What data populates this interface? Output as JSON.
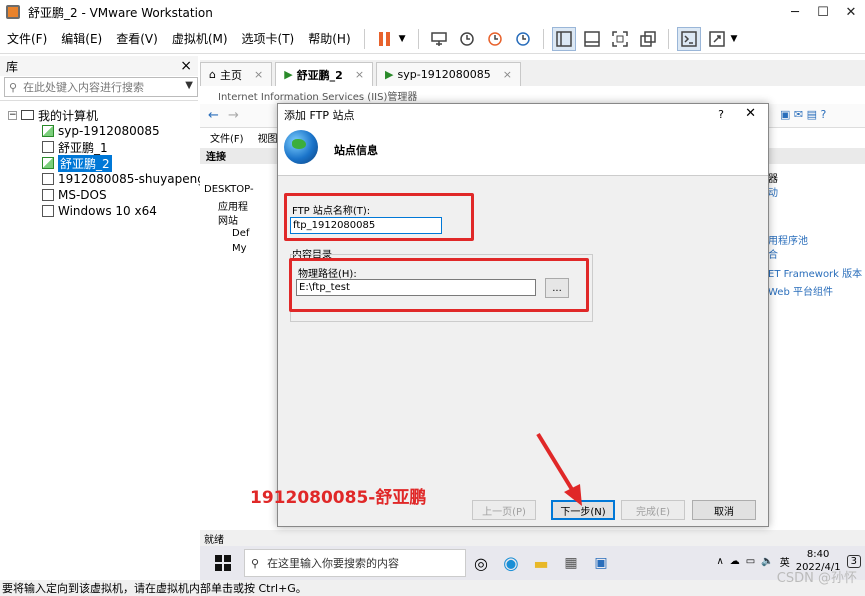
{
  "window": {
    "title": "舒亚鹏_2 - VMware Workstation"
  },
  "menu": {
    "items": [
      "文件(F)",
      "编辑(E)",
      "查看(V)",
      "虚拟机(M)",
      "选项卡(T)",
      "帮助(H)"
    ]
  },
  "library": {
    "title": "库",
    "close": "×",
    "search_placeholder": "在此处键入内容进行搜索",
    "root": "我的计算机",
    "vms": [
      "syp-1912080085",
      "舒亚鹏_1",
      "舒亚鹏_2",
      "1912080085-shuyapeng",
      "MS-DOS",
      "Windows 10 x64"
    ],
    "selected_index": 2
  },
  "tabs": [
    {
      "label": "主页",
      "close": "×"
    },
    {
      "label": "舒亚鹏_2",
      "close": "×"
    },
    {
      "label": "syp-1912080085",
      "close": "×"
    }
  ],
  "iis": {
    "title": "Internet Information Services (IIS)管理器",
    "menu": [
      "文件(F)",
      "视图("
    ],
    "connections_header": "连接",
    "tree": [
      "DESKTOP-",
      "应用程",
      "网站",
      "Def",
      "My"
    ],
    "right_links": [
      "器",
      "动",
      "用程序池",
      "合",
      "ET Framework 版本",
      "Web 平台组件"
    ],
    "status": "就绪"
  },
  "dialog": {
    "title": "添加 FTP 站点",
    "help": "?",
    "close": "✕",
    "heading": "站点信息",
    "site_name_label": "FTP 站点名称(T):",
    "site_name_value": "ftp_1912080085",
    "content_dir_label": "内容目录",
    "path_label": "物理路径(H):",
    "path_value": "E:\\ftp_test",
    "browse": "...",
    "buttons": {
      "prev": "上一页(P)",
      "next": "下一步(N)",
      "finish": "完成(E)",
      "cancel": "取消"
    }
  },
  "annotation_text": "1912080085-舒亚鹏",
  "taskbar": {
    "search_placeholder": "在这里输入你要搜索的内容",
    "ime": "英",
    "time": "8:40",
    "date": "2022/4/1",
    "notif_count": "3"
  },
  "status_bar": "要将输入定向到该虚拟机，请在虚拟机内部单击或按 Ctrl+G。",
  "watermark": "CSDN @孙怀",
  "colors": {
    "highlight_red": "#e02828",
    "accent_blue": "#0078d7",
    "pause_orange": "#e8622c"
  }
}
